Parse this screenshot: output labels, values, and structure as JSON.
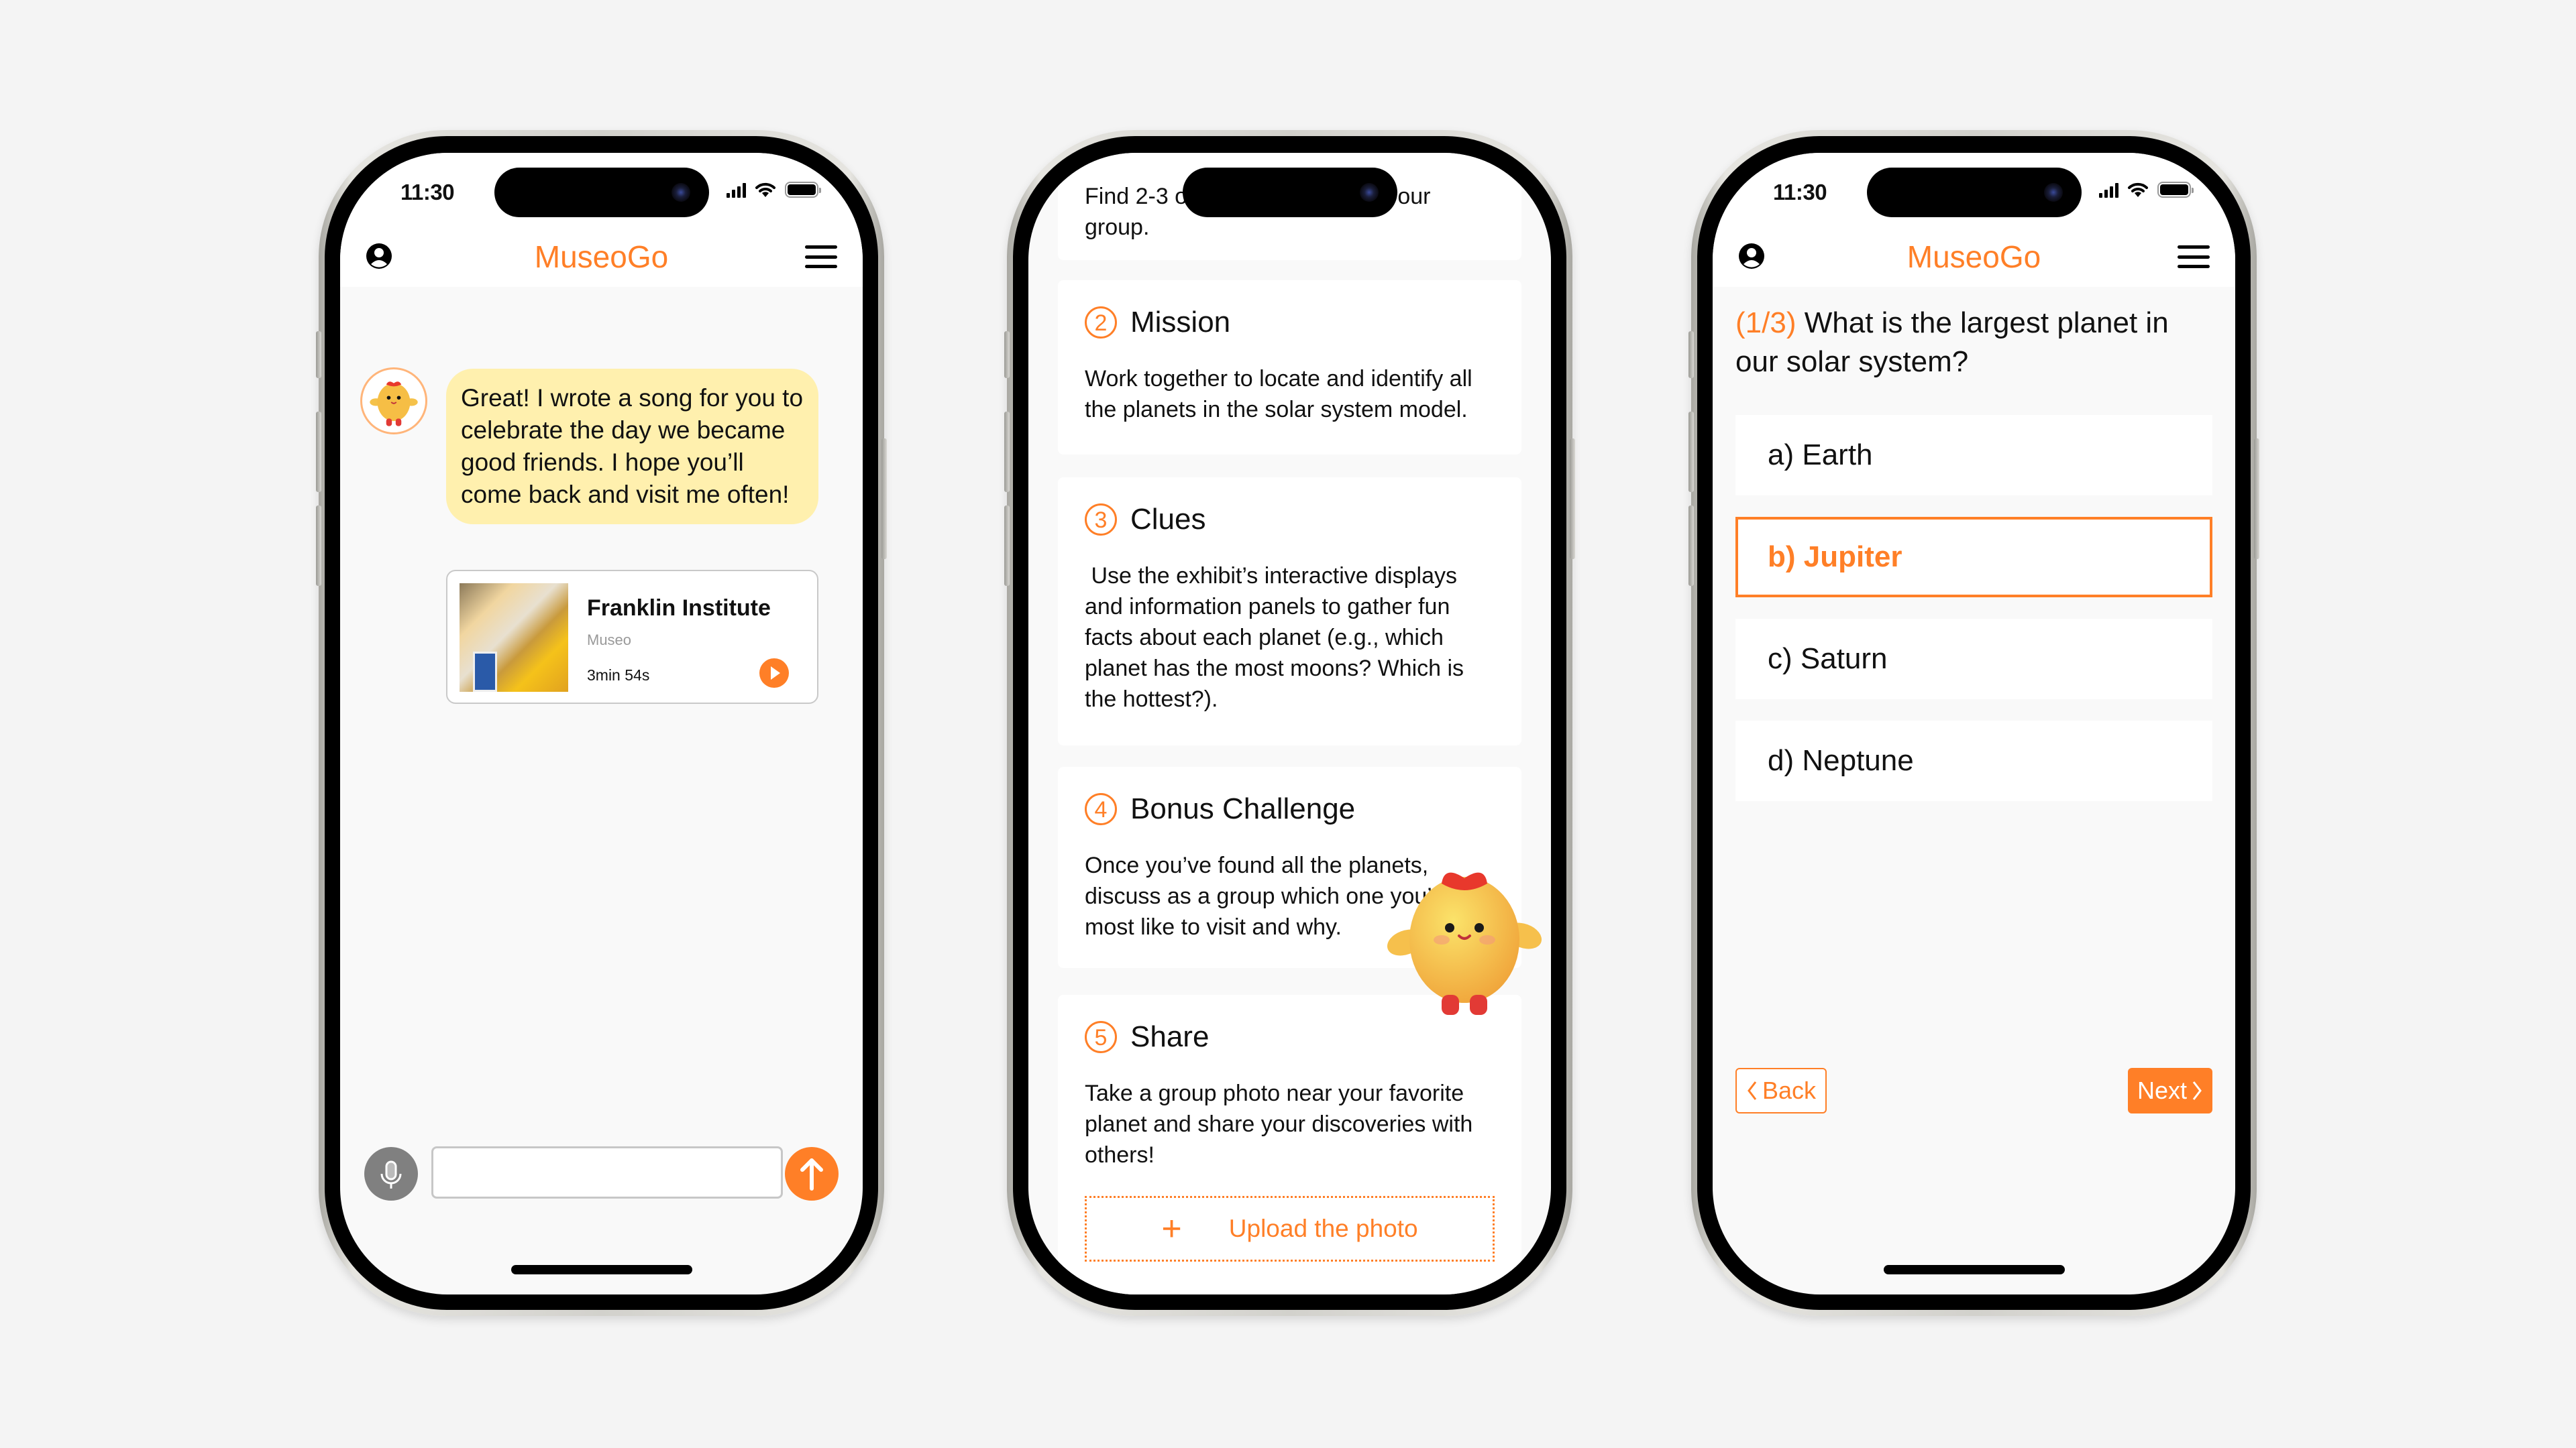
{
  "colors": {
    "accent": "#ff7f27",
    "bubble": "#fff0ae",
    "background": "#f4f4f4"
  },
  "status_bar": {
    "time": "11:30"
  },
  "app": {
    "title": "MuseoGo",
    "user_icon": "user-circle-icon",
    "menu_icon": "hamburger-menu-icon"
  },
  "chat_screen": {
    "message": "Great! I wrote a song for you to celebrate the day we became good friends. I hope you’ll come back and visit me often!",
    "song_card": {
      "name": "Franklin Institute",
      "type": "Museo",
      "duration": "3min 54s",
      "play_icon": "play-icon"
    },
    "input": {
      "value": "",
      "placeholder": ""
    },
    "mic_icon": "microphone-icon",
    "send_icon": "arrow-up-icon"
  },
  "mission_screen": {
    "intro_partial": {
      "line1_left": "Find 2-3 oth",
      "line1_right": "in your",
      "line2": "group."
    },
    "steps": [
      {
        "num": "2",
        "title": "Mission",
        "body": "Work together to locate and identify all the planets in the solar system model."
      },
      {
        "num": "3",
        "title": "Clues",
        "body": " Use the exhibit’s interactive displays and information panels to gather fun facts about each planet (e.g., which planet has the most moons? Which is the hottest?)."
      },
      {
        "num": "4",
        "title": "Bonus Challenge",
        "body": "Once you’ve found all the planets, discuss as a group which one you’d most like to visit and why."
      },
      {
        "num": "5",
        "title": "Share",
        "body": "Take a group photo near your favorite planet and share your discoveries with others!"
      }
    ],
    "upload_label": "Upload the photo",
    "upload_icon": "plus-icon"
  },
  "quiz_screen": {
    "progress": "(1/3)",
    "question": "What is the largest planet in our solar system?",
    "options": [
      {
        "label": "a) Earth",
        "selected": false
      },
      {
        "label": "b) Jupiter",
        "selected": true
      },
      {
        "label": "c) Saturn",
        "selected": false
      },
      {
        "label": "d) Neptune",
        "selected": false
      }
    ],
    "back_label": "Back",
    "next_label": "Next"
  }
}
